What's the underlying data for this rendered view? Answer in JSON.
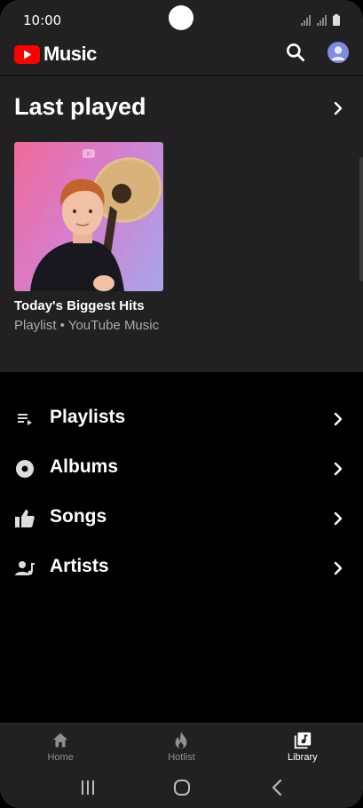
{
  "status_bar": {
    "time": "10:00"
  },
  "app_bar": {
    "logo_text": "Music",
    "icons": [
      "youtube-play-icon",
      "search-icon",
      "account-avatar"
    ]
  },
  "last_played": {
    "title": "Last played",
    "cards": [
      {
        "title": "Today's Biggest Hits",
        "subtitle": "Playlist • YouTube Music"
      }
    ]
  },
  "library": {
    "items": [
      {
        "label": "Playlists",
        "icon": "playlist-icon"
      },
      {
        "label": "Albums",
        "icon": "album-icon"
      },
      {
        "label": "Songs",
        "icon": "thumbs-up-icon"
      },
      {
        "label": "Artists",
        "icon": "artist-icon"
      }
    ]
  },
  "bottom_nav": {
    "items": [
      {
        "label": "Home",
        "icon": "home-icon"
      },
      {
        "label": "Hotlist",
        "icon": "flame-icon"
      },
      {
        "label": "Library",
        "icon": "library-music-icon",
        "active": true
      }
    ]
  },
  "system_nav": {
    "icons": [
      "recent-apps-icon",
      "home-button-icon",
      "back-icon"
    ]
  },
  "colors": {
    "surface": "#212121",
    "background": "#000000",
    "brand_red": "#ff0000",
    "secondary_text": "#aaaaaa",
    "inactive_nav": "#909090"
  }
}
